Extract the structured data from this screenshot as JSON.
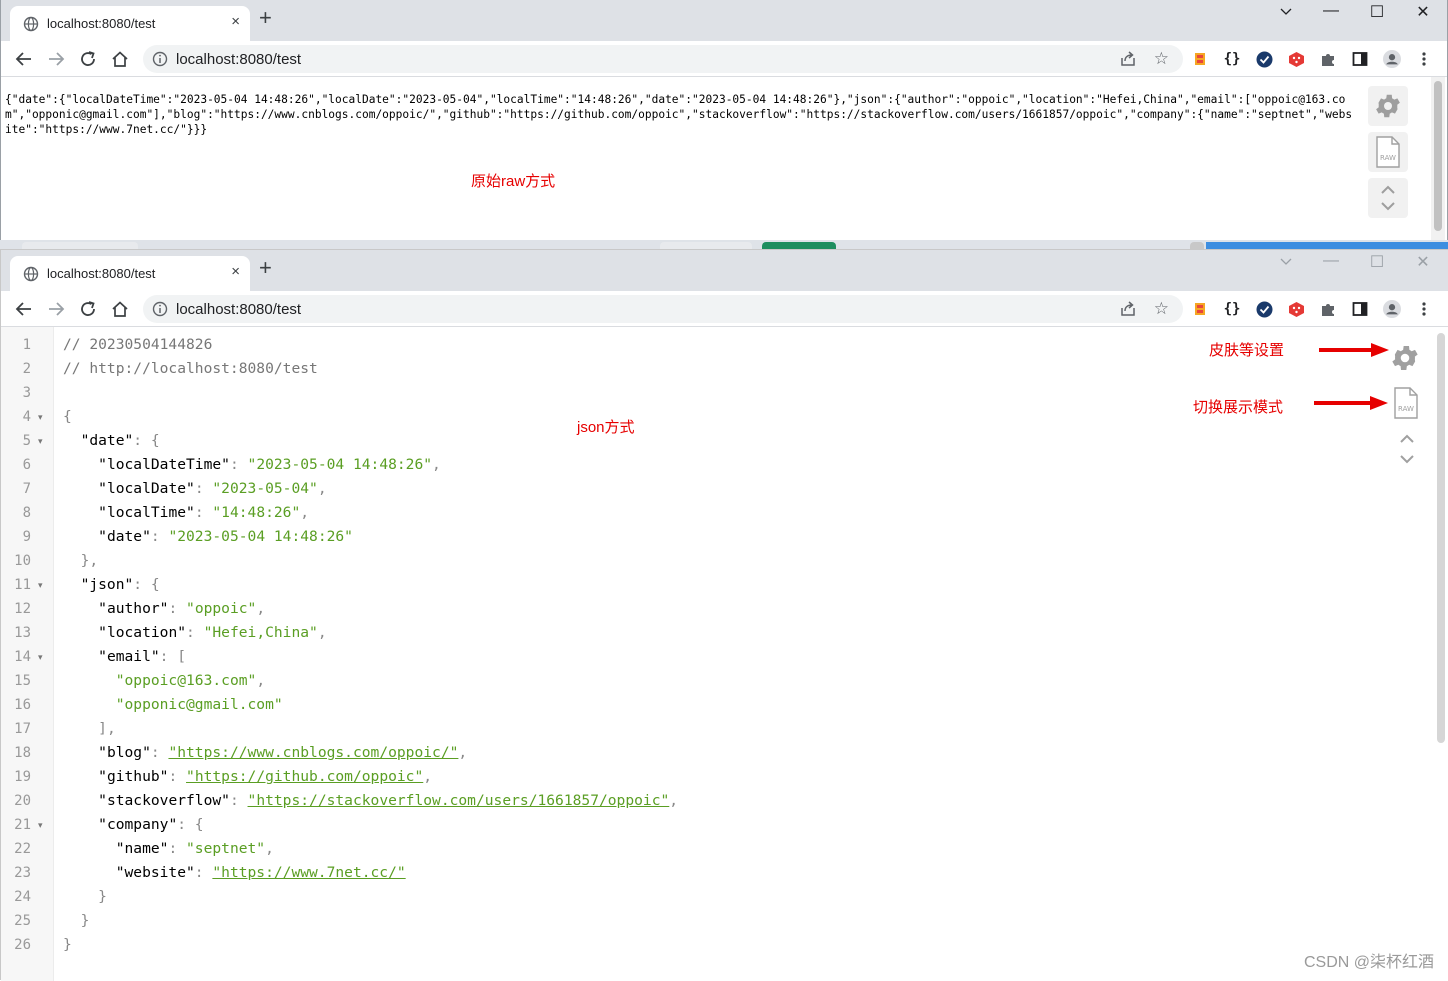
{
  "browser": {
    "tab_title": "localhost:8080/test",
    "tab_close": "×",
    "new_tab": "+",
    "url": "localhost:8080/test",
    "window_controls": {
      "minimize": "—",
      "maximize": "☐",
      "close": "✕"
    },
    "icons": [
      "back-arrow-icon",
      "forward-arrow-icon",
      "reload-icon",
      "home-icon",
      "info-icon",
      "share-icon",
      "star-icon",
      "extension-icon",
      "json-braces-icon",
      "check-shield-icon",
      "dice-icon",
      "puzzle-icon",
      "sidebar-icon",
      "profile-icon",
      "menu-dots-icon"
    ],
    "json_ext_label": "{}"
  },
  "raw_view": {
    "content": "{\"date\":{\"localDateTime\":\"2023-05-04 14:48:26\",\"localDate\":\"2023-05-04\",\"localTime\":\"14:48:26\",\"date\":\"2023-05-04 14:48:26\"},\"json\":{\"author\":\"oppoic\",\"location\":\"Hefei,China\",\"email\":[\"oppoic@163.com\",\"opponic@gmail.com\"],\"blog\":\"https://www.cnblogs.com/oppoic/\",\"github\":\"https://github.com/oppoic\",\"stackoverflow\":\"https://stackoverflow.com/users/1661857/oppoic\",\"company\":{\"name\":\"septnet\",\"website\":\"https://www.7net.cc/\"}}}",
    "annotation": "原始raw方式"
  },
  "json_view": {
    "annotation_mode": "json方式",
    "annotation_settings": "皮肤等设置",
    "annotation_toggle": "切换展示模式",
    "raw_icon_label": "RAW",
    "line_numbers": [
      "1",
      "2",
      "3",
      "4",
      "5",
      "6",
      "7",
      "8",
      "9",
      "10",
      "11",
      "12",
      "13",
      "14",
      "15",
      "16",
      "17",
      "18",
      "19",
      "20",
      "21",
      "22",
      "23",
      "24",
      "25",
      "26"
    ],
    "comment_time": "// 20230504144826",
    "comment_url": "// http://localhost:8080/test",
    "keys": {
      "date": "\"date\"",
      "localDateTime": "\"localDateTime\"",
      "localDate": "\"localDate\"",
      "localTime": "\"localTime\"",
      "date_inner": "\"date\"",
      "json": "\"json\"",
      "author": "\"author\"",
      "location": "\"location\"",
      "email": "\"email\"",
      "blog": "\"blog\"",
      "github": "\"github\"",
      "stackoverflow": "\"stackoverflow\"",
      "company": "\"company\"",
      "name": "\"name\"",
      "website": "\"website\""
    },
    "values": {
      "localDateTime": "\"2023-05-04 14:48:26\"",
      "localDate": "\"2023-05-04\"",
      "localTime": "\"14:48:26\"",
      "date_inner": "\"2023-05-04 14:48:26\"",
      "author": "\"oppoic\"",
      "location": "\"Hefei,China\"",
      "email_0": "\"oppoic@163.com\"",
      "email_1": "\"opponic@gmail.com\"",
      "blog": "\"https://www.cnblogs.com/oppoic/\"",
      "github": "\"https://github.com/oppoic\"",
      "stackoverflow": "\"https://stackoverflow.com/users/1661857/oppoic\"",
      "name": "\"septnet\"",
      "website": "\"https://www.7net.cc/\""
    }
  },
  "watermark": "CSDN @柒杯红酒",
  "colors": {
    "annotation": "#e60000",
    "string": "#5a9e23",
    "punct": "#888888",
    "tab_strip": "#dee1e6"
  }
}
